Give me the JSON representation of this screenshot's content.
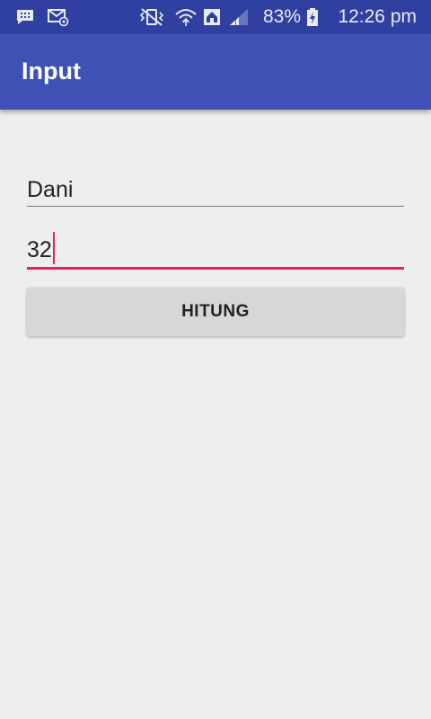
{
  "status_bar": {
    "icons": [
      "message-notification-icon",
      "email-notification-icon",
      "vibrate-mute-icon",
      "wifi-icon",
      "home-network-icon",
      "signal-icon",
      "battery-charging-icon"
    ],
    "battery_percent": "83%",
    "time": "12:26 pm"
  },
  "app_bar": {
    "title": "Input"
  },
  "form": {
    "name_value": "Dani",
    "age_value": "32",
    "button_label": "HITUNG"
  },
  "colors": {
    "status_bar": "#2f40a0",
    "app_bar": "#3f51b5",
    "accent": "#e91e63",
    "background": "#eeeeee",
    "button": "#d6d7d7"
  }
}
